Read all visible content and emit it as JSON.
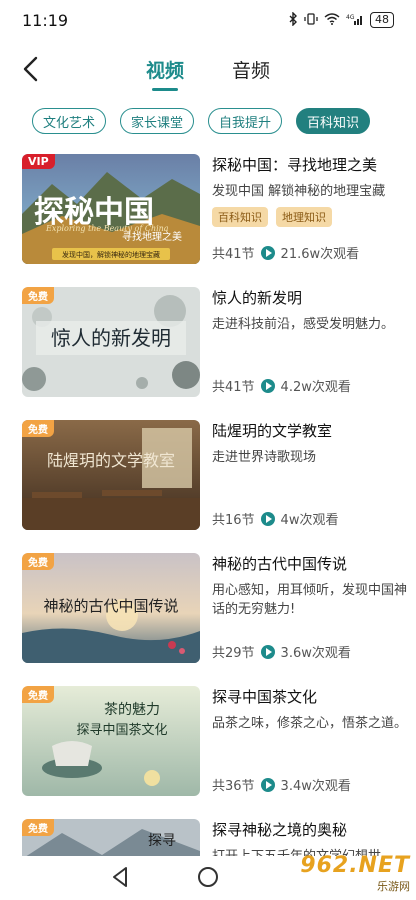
{
  "status_bar": {
    "time": "11:19",
    "battery": "48",
    "signal": "4G"
  },
  "tabs": [
    {
      "label": "视频",
      "active": true
    },
    {
      "label": "音频",
      "active": false
    }
  ],
  "categories": [
    {
      "label": "文化艺术",
      "active": false
    },
    {
      "label": "家长课堂",
      "active": false
    },
    {
      "label": "自我提升",
      "active": false
    },
    {
      "label": "百科知识",
      "active": true
    }
  ],
  "videos": [
    {
      "badge": "VIP",
      "badge_type": "vip",
      "title": "探秘中国：寻找地理之美",
      "desc": "发现中国 解锁神秘的地理宝藏",
      "tags": [
        "百科知识",
        "地理知识"
      ],
      "lessons": "共41节",
      "views": "21.6w次观看",
      "thumb_text": "探秘中国",
      "thumb_sub": "寻找地理之美",
      "thumb_en": "Exploring the Beauty of China",
      "thumb_banner": "发现中国，解锁神秘的地理宝藏"
    },
    {
      "badge": "免费",
      "badge_type": "free",
      "title": "惊人的新发明",
      "desc": "走进科技前沿，感受发明魅力。",
      "tags": [],
      "lessons": "共41节",
      "views": "4.2w次观看",
      "thumb_text": "惊人的新发明"
    },
    {
      "badge": "免费",
      "badge_type": "free",
      "title": "陆煋玥的文学教室",
      "desc": "走进世界诗歌现场",
      "tags": [],
      "lessons": "共16节",
      "views": "4w次观看",
      "thumb_text": "陆煋玥的文学教室"
    },
    {
      "badge": "免费",
      "badge_type": "free",
      "title": "神秘的古代中国传说",
      "desc": "用心感知，用耳倾听，发现中国神话的无穷魅力!",
      "tags": [],
      "lessons": "共29节",
      "views": "3.6w次观看",
      "thumb_text": "神秘的古代中国传说"
    },
    {
      "badge": "免费",
      "badge_type": "free",
      "title": "探寻中国茶文化",
      "desc": "品茶之味，修茶之心，悟茶之道。",
      "tags": [],
      "lessons": "共36节",
      "views": "3.4w次观看",
      "thumb_text": "茶的魅力",
      "thumb_sub": "探寻中国茶文化"
    },
    {
      "badge": "免费",
      "badge_type": "free",
      "title": "探寻神秘之境的奥秘",
      "desc": "打开上下五千年的文学幻想世",
      "tags": [],
      "lessons": "",
      "views": "",
      "thumb_text": "探寻"
    }
  ],
  "watermark": {
    "main": "962.NET",
    "sub": "乐游网"
  },
  "colors": {
    "accent": "#1d8b8b",
    "vip": "#d81f2b",
    "free": "#f2a344",
    "tag_bg": "#f5d9a6"
  }
}
